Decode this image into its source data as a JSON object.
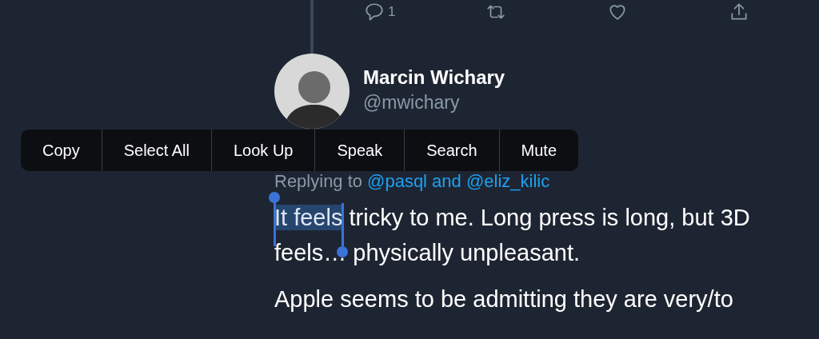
{
  "actions": [
    {
      "kind": "reply",
      "count": "1"
    },
    {
      "kind": "retweet"
    },
    {
      "kind": "like"
    },
    {
      "kind": "share"
    }
  ],
  "author": {
    "name": "Marcin Wichary",
    "handle": "@mwichary"
  },
  "context_menu": {
    "items": [
      "Copy",
      "Select All",
      "Look Up",
      "Speak",
      "Search",
      "Mute"
    ]
  },
  "replying": {
    "label": "Replying to",
    "targets": "@pasql and @eliz_kilic"
  },
  "paragraphs": [
    {
      "lines": [
        {
          "selected_text": "It feels",
          "text": " tricky to me. Long press is long, but 3D"
        },
        {
          "text": "feels… physically unpleasant."
        }
      ]
    },
    {
      "lines": [
        {
          "text": "Apple seems to be admitting they are very/to"
        }
      ]
    }
  ]
}
